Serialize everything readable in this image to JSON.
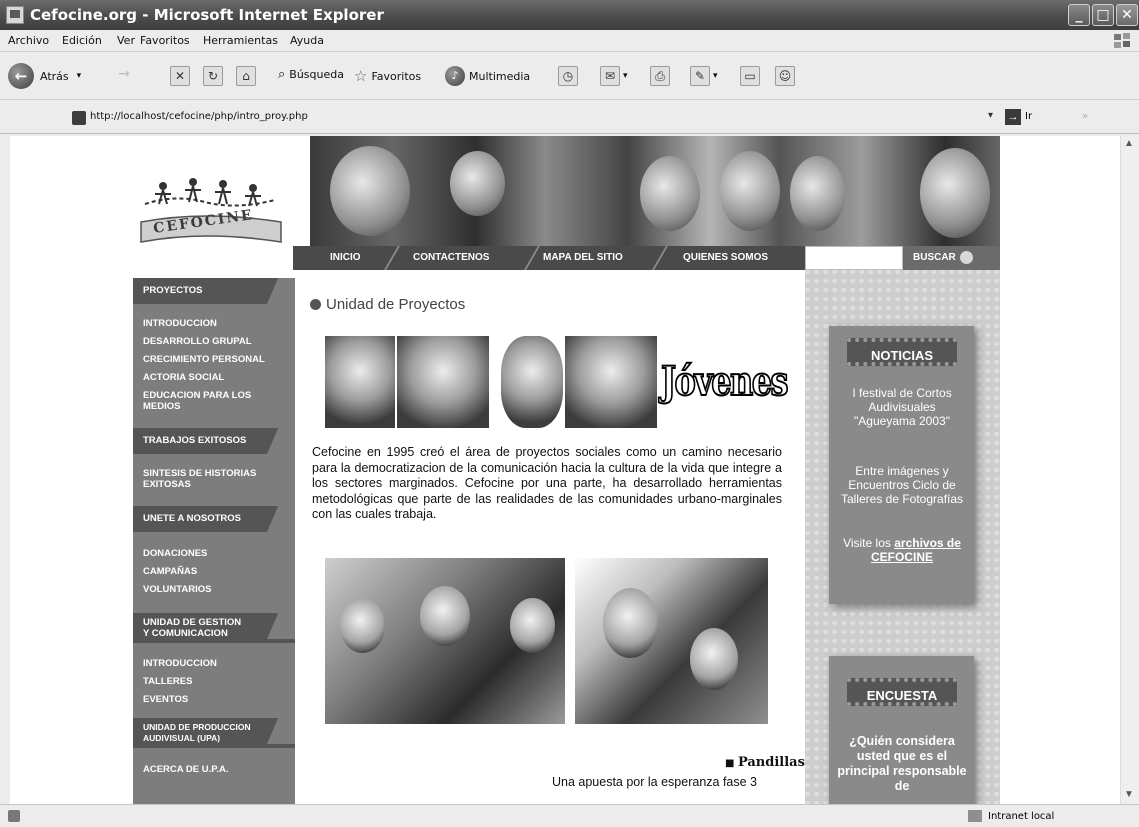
{
  "window": {
    "title": "Cefocine.org - Microsoft Internet Explorer",
    "minimize": "_",
    "maximize": "□",
    "close": "✕"
  },
  "menubar": {
    "items": [
      "Archivo",
      "Edición",
      "Ver",
      "Favoritos",
      "Herramientas",
      "Ayuda"
    ]
  },
  "toolbar": {
    "back_label": "Atrás",
    "search_label": "Búsqueda",
    "favorites_label": "Favoritos",
    "multimedia_label": "Multimedia"
  },
  "addressbar": {
    "url": "http://localhost/cefocine/php/intro_proy.php",
    "go_label": "Ir"
  },
  "logo": {
    "text": "CEFOCINE"
  },
  "nav": {
    "items": [
      "INICIO",
      "CONTACTENOS",
      "MAPA DEL SITIO",
      "QUIENES SOMOS"
    ],
    "search_button": "BUSCAR"
  },
  "sidebar": {
    "sections": [
      {
        "header": "PROYECTOS",
        "items": [
          "INTRODUCCION",
          "DESARROLLO GRUPAL",
          "CRECIMIENTO  PERSONAL",
          "ACTORIA SOCIAL",
          "EDUCACION PARA LOS",
          "MEDIOS"
        ]
      },
      {
        "header": "TRABAJOS EXITOSOS",
        "items": [
          "SINTESIS DE HISTORIAS",
          "EXITOSAS"
        ]
      },
      {
        "header": "UNETE A NOSOTROS",
        "items": [
          "DONACIONES",
          "CAMPAÑAS",
          "VOLUNTARIOS"
        ]
      },
      {
        "header": "UNIDAD DE GESTION",
        "header2": "Y COMUNICACION",
        "items": [
          "INTRODUCCION",
          "TALLERES",
          "EVENTOS"
        ]
      },
      {
        "header": "UNIDAD DE PRODUCCION",
        "header2": "AUDIVISUAL (UPA)",
        "items": [
          "ACERCA DE U.P.A."
        ]
      }
    ]
  },
  "main": {
    "title": "Unidad de Proyectos",
    "banner_word": "Jóvenes",
    "intro": "Cefocine en 1995 creó el área de proyectos sociales como un camino necesario para la democratizacion de la comunicación hacia la cultura de la vida que integre a los sectores marginados. Cefocine por una parte, ha desarrollado herramientas metodológicas que parte de las realidades de las comunidades urbano-marginales con las cuales trabaja.",
    "feature_title": "Pandillas",
    "feature_subtitle": "Una apuesta por la esperanza fase 3"
  },
  "news": {
    "title": "NOTICIAS",
    "item1": "I festival de Cortos Audivisuales \"Agueyama 2003\"",
    "item2": "Entre imágenes y Encuentros Ciclo de Talleres de Fotografías",
    "visit_prefix": "Visite los",
    "visit_link": "archivos de CEFOCINE"
  },
  "poll": {
    "title": "ENCUESTA",
    "question": "¿Quién considera usted que es el principal responsable de"
  },
  "statusbar": {
    "zone": "Intranet local"
  }
}
